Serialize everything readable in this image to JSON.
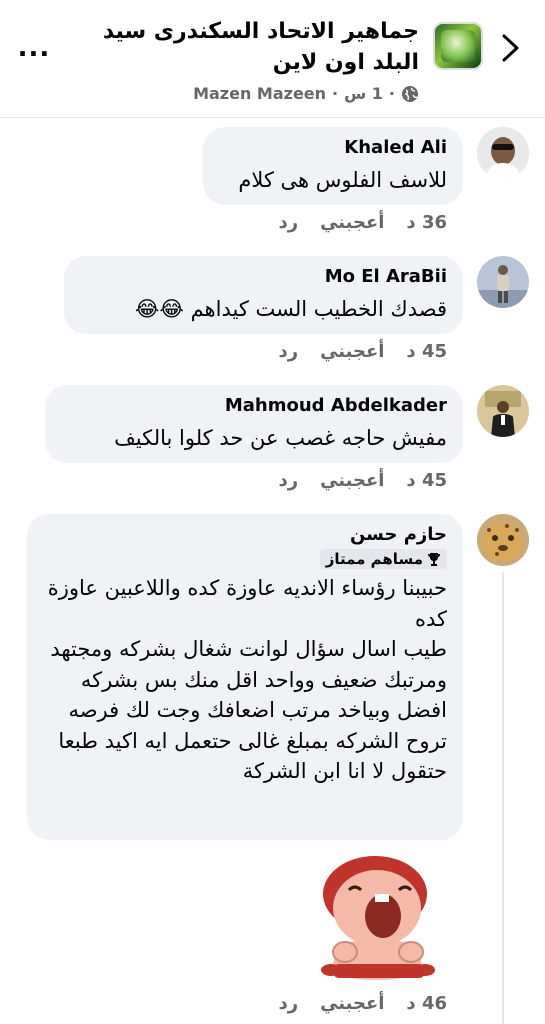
{
  "header": {
    "title": "جماهير الاتحاد السكندرى سيد البلد اون لاين",
    "author": "Mazen Mazeen",
    "time": "1 س",
    "more_label": "..."
  },
  "comments": [
    {
      "author": "Khaled Ali",
      "text": "للاسف الفلوس هى كلام",
      "time": "36 د",
      "like_label": "أعجبني",
      "reply_label": "رد"
    },
    {
      "author": "Mo El AraBii",
      "text": "قصدك الخطيب الست كيداهم 😂😂",
      "time": "45 د",
      "like_label": "أعجبني",
      "reply_label": "رد"
    },
    {
      "author": "Mahmoud Abdelkader",
      "text": "مفيش حاجه غصب عن حد كلوا بالكيف",
      "time": "45 د",
      "like_label": "أعجبني",
      "reply_label": "رد"
    },
    {
      "author": "حازم حسن",
      "badge": "مساهم ممتاز",
      "text": "حبيبنا رؤساء الانديه عاوزة كده واللاعبين عاوزة كده\nطيب اسال سؤال لوانت شغال بشركه ومجتهد ومرتبك ضعيف وواحد اقل منك بس بشركه افضل وبياخد مرتب اضعافك وجت لك فرصه تروح الشركه بمبلغ غالى حتعمل ايه اكيد طبعا حتقول لا انا ابن الشركة",
      "time": "46 د",
      "like_label": "أعجبني",
      "reply_label": "رد"
    }
  ],
  "colors": {
    "bubble": "#f0f2f5",
    "secondary_text": "#65676b",
    "primary_text": "#050505"
  }
}
